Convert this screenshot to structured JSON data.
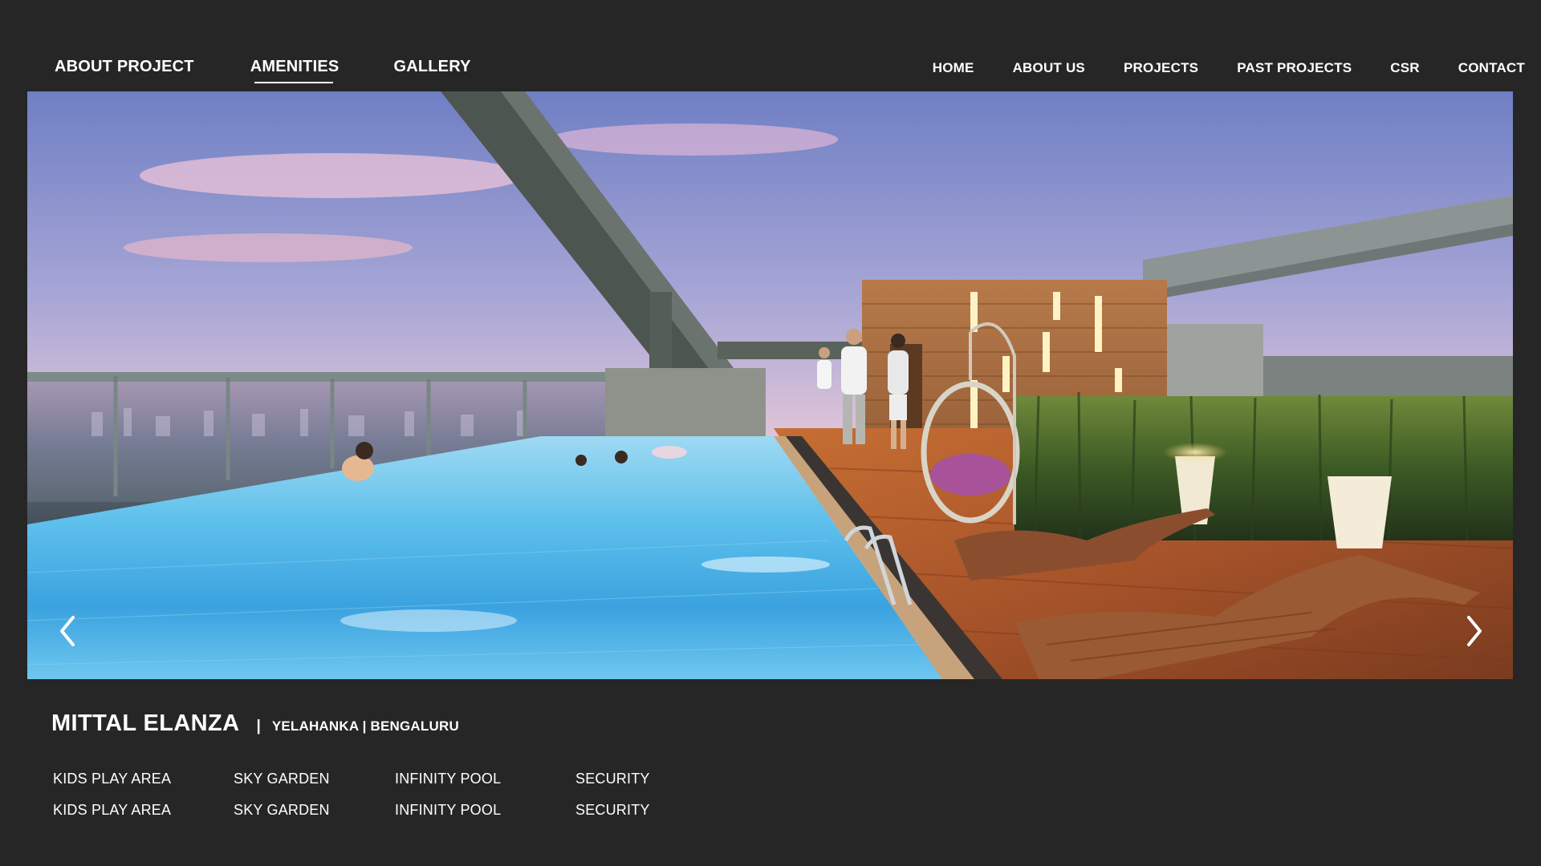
{
  "project_nav": {
    "items": [
      {
        "label": "ABOUT PROJECT",
        "active": false
      },
      {
        "label": "AMENITIES",
        "active": true
      },
      {
        "label": "GALLERY",
        "active": false
      }
    ]
  },
  "main_nav": {
    "items": [
      {
        "label": "HOME"
      },
      {
        "label": "ABOUT US"
      },
      {
        "label": "PROJECTS"
      },
      {
        "label": "PAST PROJECTS"
      },
      {
        "label": "CSR"
      },
      {
        "label": "CONTACT"
      }
    ]
  },
  "slider": {
    "prev_icon": "chevron-left-icon",
    "next_icon": "chevron-right-icon"
  },
  "project": {
    "name": "MITTAL ELANZA",
    "separator": "|",
    "location": "YELAHANKA | BENGALURU"
  },
  "amenities": {
    "rows": [
      [
        "KIDS PLAY AREA",
        "SKY GARDEN",
        "INFINITY POOL",
        "SECURITY"
      ],
      [
        "KIDS PLAY AREA",
        "SKY GARDEN",
        "INFINITY POOL",
        "SECURITY"
      ]
    ]
  },
  "colors": {
    "background": "#262626",
    "text": "#ffffff",
    "pool": "#4fb3e8",
    "deck": "#b0643a",
    "sky_top": "#7c86c4",
    "sky_horizon": "#f3d7c8"
  }
}
